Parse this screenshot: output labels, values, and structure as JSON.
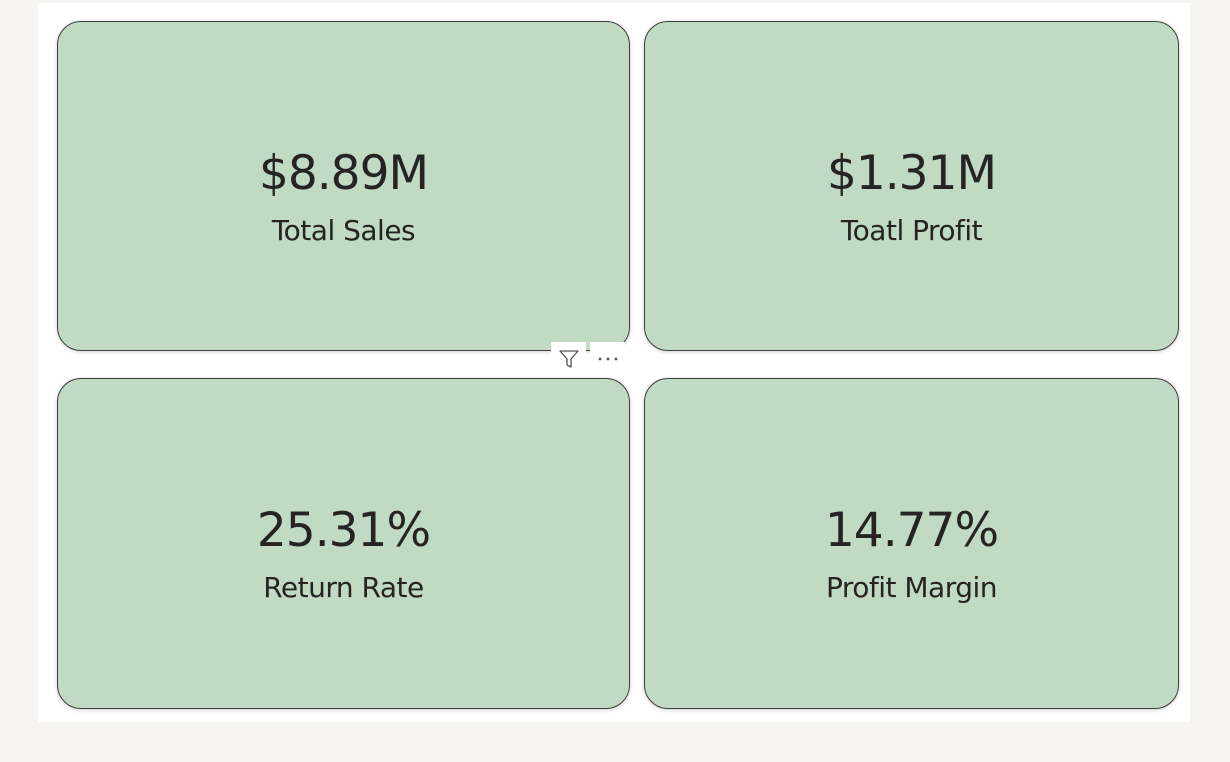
{
  "kpis": [
    {
      "value": "$8.89M",
      "label": "Total Sales"
    },
    {
      "value": "$1.31M",
      "label": "Toatl Profit"
    },
    {
      "value": "25.31%",
      "label": "Return Rate"
    },
    {
      "value": "14.77%",
      "label": "Profit Margin"
    }
  ],
  "visual_header": {
    "filter_icon": "filter-icon",
    "more_icon": "more-options-icon"
  },
  "colors": {
    "card_fill": "#c1dac3",
    "card_border": "#3d3d3d",
    "text": "#252423",
    "background": "#f6f5f2"
  }
}
